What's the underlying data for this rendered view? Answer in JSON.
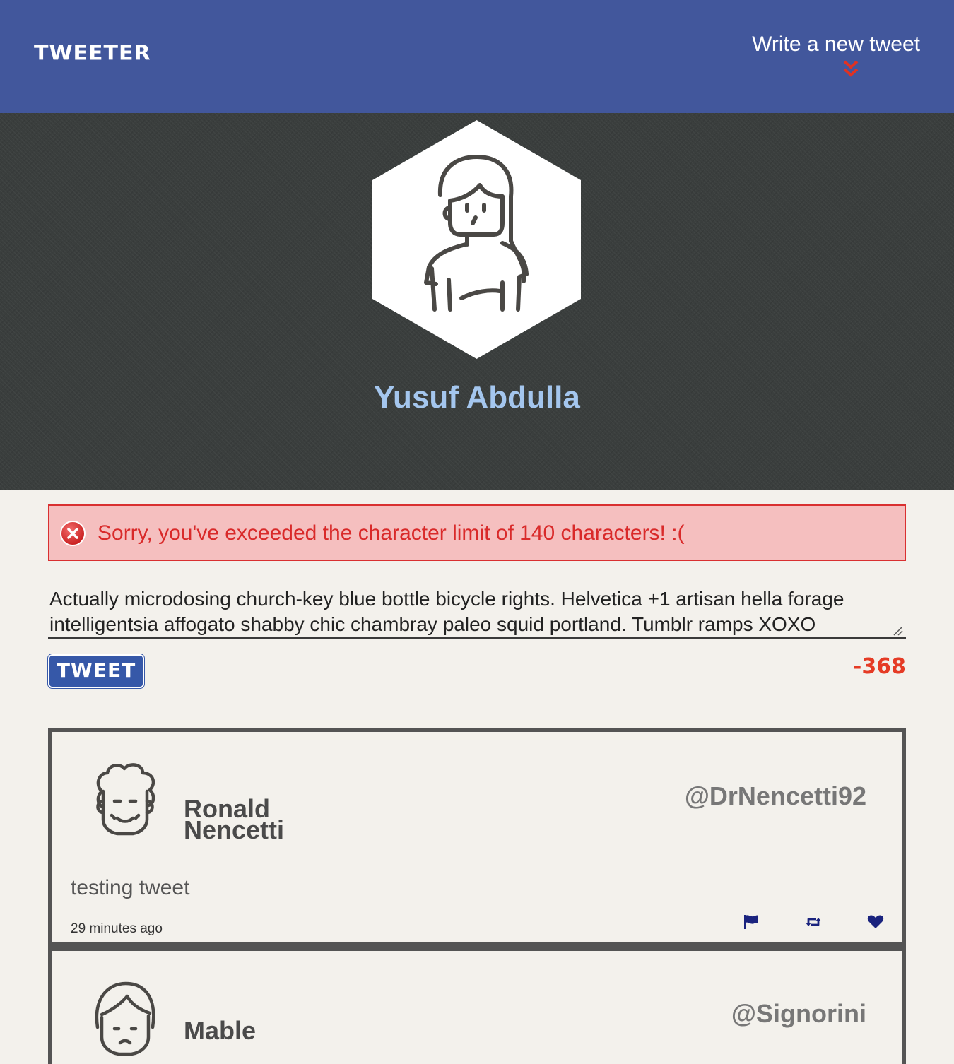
{
  "nav": {
    "brand": "TWEETER",
    "compose_label": "Write a new tweet"
  },
  "profile": {
    "name": "Yusuf Abdulla"
  },
  "error": {
    "message": "Sorry, you've exceeded the character limit of 140 characters! :("
  },
  "compose": {
    "value": "Actually microdosing church-key blue bottle bicycle rights. Helvetica +1 artisan hella forage intelligentsia affogato shabby chic chambray paleo squid portland. Tumblr ramps XOXO",
    "button_label": "TWEET",
    "counter": "-368"
  },
  "tweets": [
    {
      "name": "Ronald Nencetti",
      "handle": "@DrNencetti92",
      "text": "testing tweet",
      "time": "29 minutes ago"
    },
    {
      "name": "Mable",
      "handle": "@Signorini"
    }
  ],
  "icons": {
    "compose_chevron": "chevron-double-down-icon",
    "error": "close-circle-icon",
    "flag": "flag-icon",
    "retweet": "retweet-icon",
    "heart": "heart-icon"
  },
  "colors": {
    "nav_bg": "#42579c",
    "profile_name": "#a4c6ee",
    "error_bg": "#f5bfbf",
    "error_text": "#d92a2a",
    "counter": "#e53b25",
    "button_bg": "#3658a8",
    "action_icon": "#1a237e"
  }
}
